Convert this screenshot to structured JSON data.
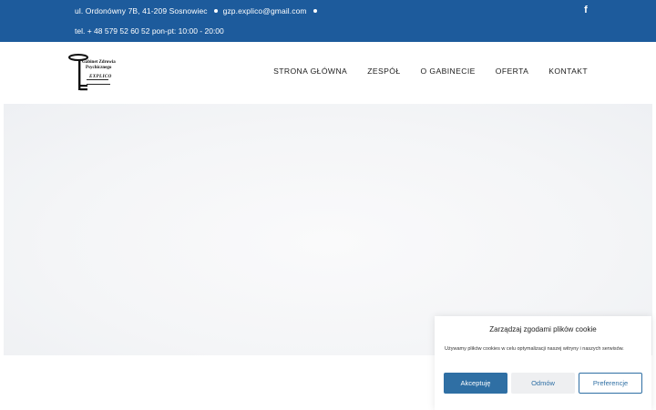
{
  "colors": {
    "topbar_bg": "#1d5b9c",
    "accent": "#2f6fa4",
    "text_dark": "#1c1c1c"
  },
  "topbar": {
    "address": "ul. Ordonówny 7B, 41-209 Sosnowiec",
    "email": "gzp.explico@gmail.com",
    "phone_hours": "tel. + 48 579 52 60 52 pon-pt: 10:00 - 20:00",
    "social_icon": "facebook-icon",
    "social_glyph": "f"
  },
  "logo": {
    "line1": "Gabinet Zdrowia",
    "line2": "Psychicznego",
    "line3": "EXPLICO",
    "icon": "key-icon"
  },
  "nav": {
    "items": [
      {
        "label": "STRONA GŁÓWNA"
      },
      {
        "label": "ZESPÓŁ"
      },
      {
        "label": "O GABINECIE"
      },
      {
        "label": "OFERTA"
      },
      {
        "label": "KONTAKT"
      }
    ]
  },
  "cookie": {
    "title": "Zarządzaj zgodami plików cookie",
    "text": "Używamy plików cookies w celu optymalizacji naszej witryny i naszych serwisów.",
    "accept_label": "Akceptuję",
    "deny_label": "Odmów",
    "prefs_label": "Preferencje"
  }
}
